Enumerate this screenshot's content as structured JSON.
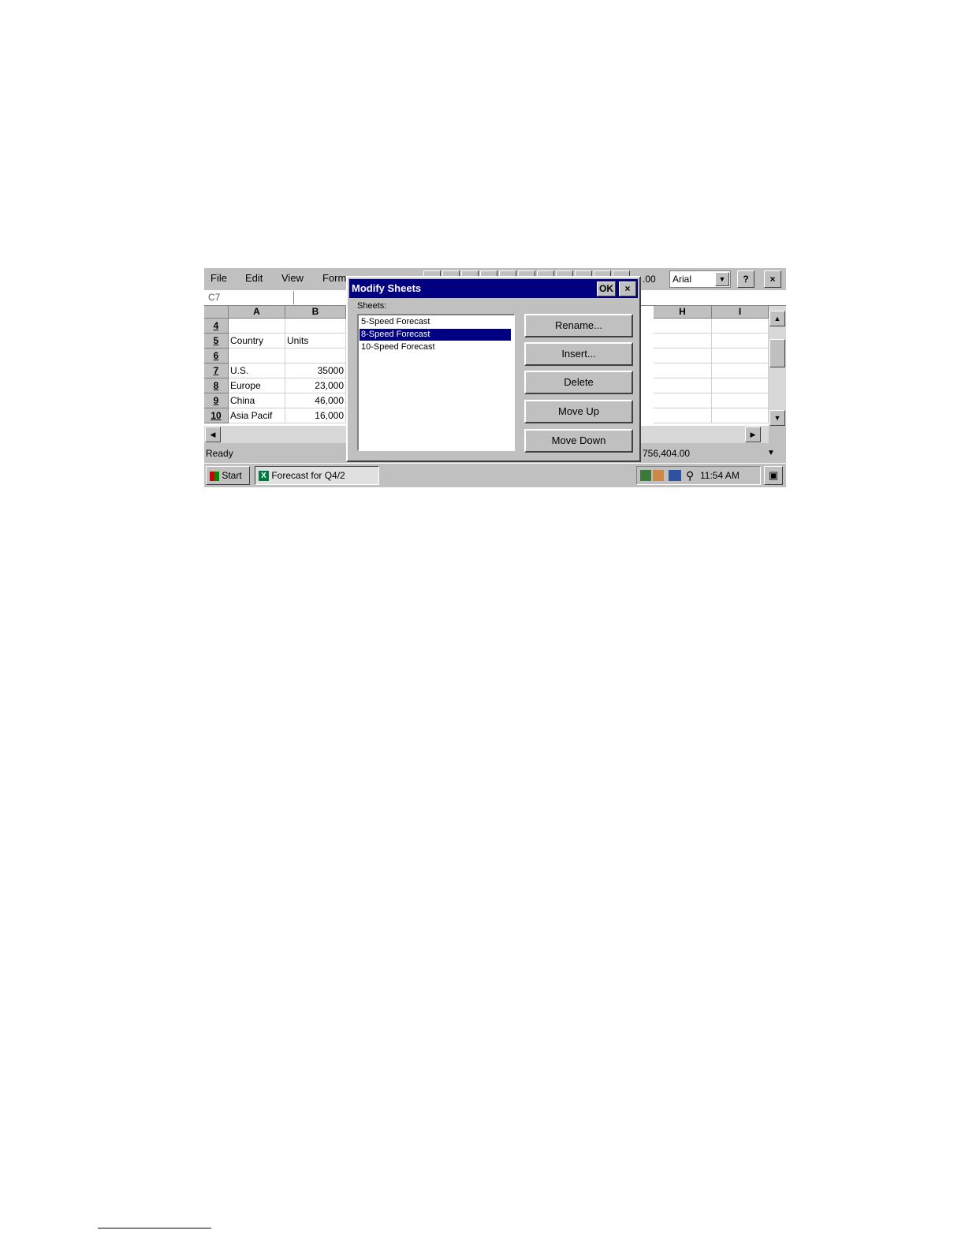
{
  "menu": {
    "file": "File",
    "edit": "Edit",
    "view": "View",
    "format": "Form"
  },
  "toolbar": {
    "zoom": ".00",
    "font": "Arial",
    "help": "?",
    "close": "×"
  },
  "formula_bar": {
    "cell_ref": "C7"
  },
  "columns": [
    "A",
    "B",
    "H",
    "I"
  ],
  "rows": [
    {
      "num": "4",
      "a": "",
      "b": ""
    },
    {
      "num": "5",
      "a": "Country",
      "b": "Units"
    },
    {
      "num": "6",
      "a": "",
      "b": ""
    },
    {
      "num": "7",
      "a": "U.S.",
      "b": "35000"
    },
    {
      "num": "8",
      "a": "Europe",
      "b": "23,000"
    },
    {
      "num": "9",
      "a": "China",
      "b": "46,000"
    },
    {
      "num": "10",
      "a": "Asia Pacif",
      "b": "16,000"
    }
  ],
  "status": {
    "left": "Ready",
    "sum": "756,404.00"
  },
  "taskbar": {
    "start": "Start",
    "task": "Forecast for Q4/2",
    "time": "11:54 AM"
  },
  "dialog": {
    "title": "Modify Sheets",
    "ok": "OK",
    "close": "×",
    "sheets_label": "Sheets:",
    "sheets": [
      "5-Speed Forecast",
      "8-Speed Forecast",
      "10-Speed Forecast"
    ],
    "selected_index": 1,
    "buttons": {
      "rename": "Rename...",
      "insert": "Insert...",
      "delete": "Delete",
      "move_up": "Move Up",
      "move_down": "Move Down"
    }
  }
}
